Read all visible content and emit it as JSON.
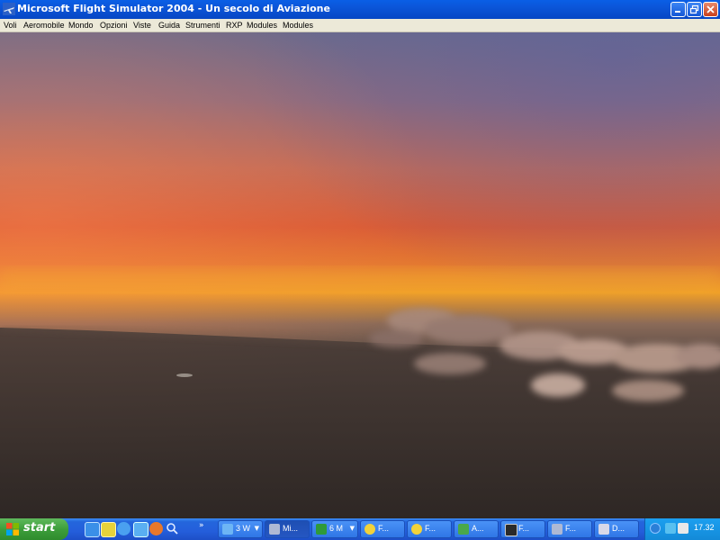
{
  "window": {
    "title": "Microsoft Flight Simulator 2004 - Un secolo di Aviazione",
    "icon": "plane-icon",
    "controls": [
      "minimize-icon",
      "restore-icon",
      "close-icon"
    ]
  },
  "menu": {
    "items": [
      "Voli",
      "Aeromobile",
      "Mondo",
      "Opzioni",
      "Viste",
      "Guida",
      "Strumenti",
      "RXP",
      "Modules",
      "Modules"
    ]
  },
  "scene": {
    "description_icon": "sunset-sky-over-clouds",
    "colors": {
      "sky_top": "#6a6a8e",
      "sky_mid": "#d85a35",
      "horizon_glow": "#f0a028",
      "haze": "#8a6a58",
      "ground": "#3a302c"
    }
  },
  "taskbar": {
    "start_label": "start",
    "quicklaunch_icons": [
      "ie-icon",
      "media-icon",
      "outlook-icon",
      "desktop-icon",
      "firefox-icon",
      "search-icon"
    ],
    "quicklaunch_more": "»",
    "tasks": [
      {
        "label": "3 W",
        "icon": "windows-icon",
        "dropdown": true,
        "active": false
      },
      {
        "label": "Mi...",
        "icon": "plane-icon",
        "dropdown": false,
        "active": true
      },
      {
        "label": "6 M",
        "icon": "excel-icon",
        "dropdown": true,
        "active": false
      },
      {
        "label": "F...",
        "icon": "sun-icon",
        "dropdown": false,
        "active": false
      },
      {
        "label": "F...",
        "icon": "sun-icon",
        "dropdown": false,
        "active": false
      },
      {
        "label": "A...",
        "icon": "plane-green-icon",
        "dropdown": false,
        "active": false
      },
      {
        "label": "F...",
        "icon": "monitor-icon",
        "dropdown": false,
        "active": false
      },
      {
        "label": "F...",
        "icon": "plane-icon",
        "dropdown": false,
        "active": false
      },
      {
        "label": "D...",
        "icon": "drive-icon",
        "dropdown": false,
        "active": false
      }
    ],
    "tray": {
      "icons": [
        "network-icon",
        "volume-icon",
        "shield-icon"
      ],
      "clock": "17.32"
    }
  }
}
